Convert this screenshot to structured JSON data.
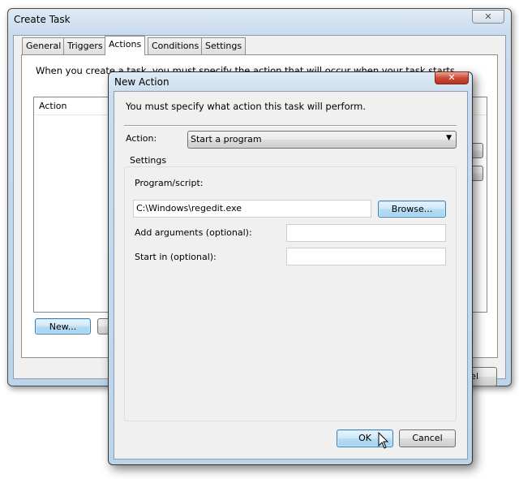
{
  "parent_window": {
    "title": "Create Task",
    "tabs": [
      {
        "label": "General"
      },
      {
        "label": "Triggers"
      },
      {
        "label": "Actions"
      },
      {
        "label": "Conditions"
      },
      {
        "label": "Settings"
      }
    ],
    "active_tab": "Actions",
    "description": "When you create a task, you must specify the action that will occur when your task starts.",
    "list_header": "Action",
    "new_button": "New...",
    "cancel_partial": "el"
  },
  "dialog": {
    "title": "New Action",
    "instruction": "You must specify what action this task will perform.",
    "action_label": "Action:",
    "action_value": "Start a program",
    "settings_group": "Settings",
    "program_label": "Program/script:",
    "program_value": "C:\\Windows\\regedit.exe",
    "browse_button": "Browse...",
    "args_label": "Add arguments (optional):",
    "args_value": "",
    "start_in_label": "Start in (optional):",
    "start_in_value": "",
    "ok_button": "OK",
    "cancel_button": "Cancel"
  }
}
